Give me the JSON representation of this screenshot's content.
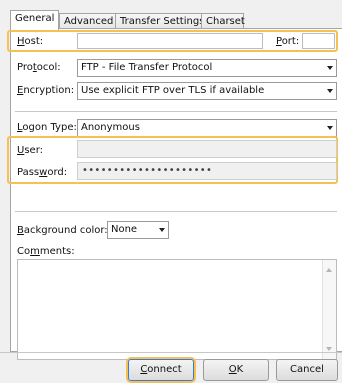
{
  "tabs": [
    {
      "label": "General",
      "active": true
    },
    {
      "label": "Advanced",
      "active": false
    },
    {
      "label": "Transfer Settings",
      "active": false
    },
    {
      "label": "Charset",
      "active": false
    }
  ],
  "host": {
    "label_key": "H",
    "label_rest": "ost:",
    "value": ""
  },
  "port": {
    "label_key": "P",
    "label_rest": "ort:",
    "value": ""
  },
  "protocol": {
    "label_pre": "Pro",
    "label_key": "t",
    "label_rest": "ocol:",
    "selected": "FTP - File Transfer Protocol"
  },
  "encryption": {
    "label_key": "E",
    "label_rest": "ncryption:",
    "selected": "Use explicit FTP over TLS if available"
  },
  "logon_type": {
    "label_key": "L",
    "label_rest": "ogon Type:",
    "selected": "Anonymous"
  },
  "user": {
    "label_key": "U",
    "label_rest": "ser:",
    "value": ""
  },
  "password": {
    "label_pre": "Pass",
    "label_key": "w",
    "label_rest": "ord:",
    "value": "•••••••••••••••••••••"
  },
  "background_color": {
    "label_key": "B",
    "label_rest": "ackground color:",
    "selected": "None"
  },
  "comments": {
    "label_pre": "Co",
    "label_key": "m",
    "label_rest": "ments:",
    "value": ""
  },
  "buttons": {
    "connect": {
      "key": "C",
      "rest": "onnect"
    },
    "ok": {
      "key": "O",
      "rest": "K"
    },
    "cancel": {
      "label": "Cancel"
    }
  },
  "colors": {
    "highlight": "#f5c054",
    "default_button_border": "#3a7bd5"
  }
}
